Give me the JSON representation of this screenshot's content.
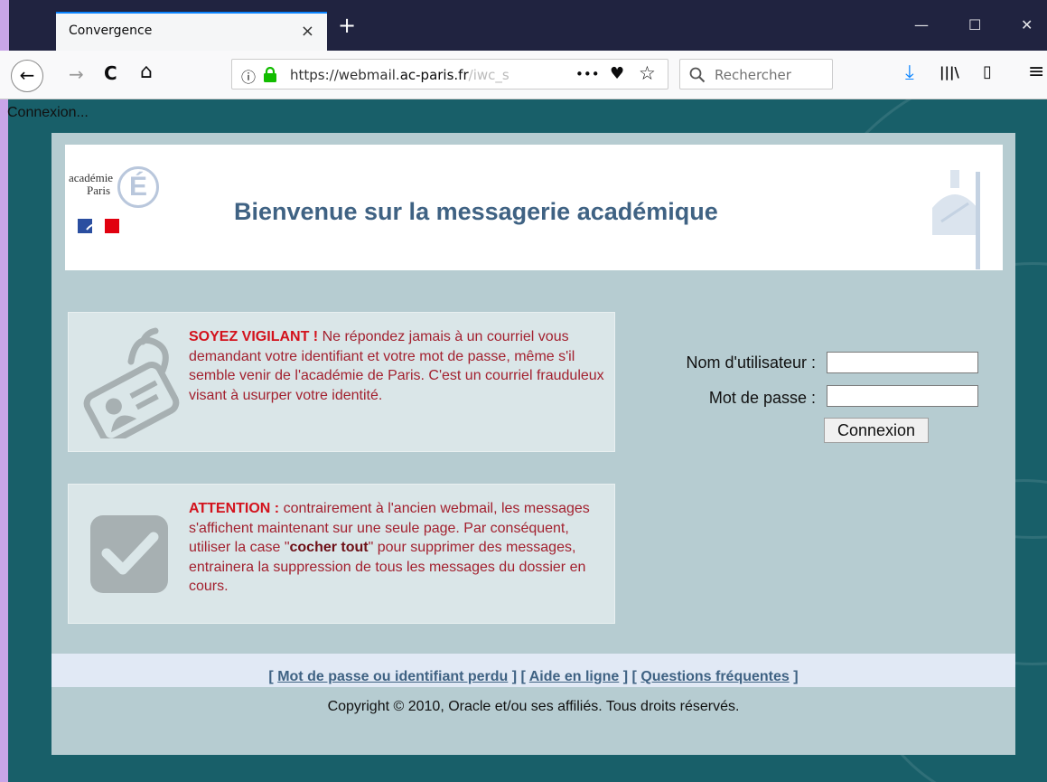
{
  "browser": {
    "tab_title": "Convergence",
    "tab_close": "×",
    "new_tab": "+",
    "window_min": "—",
    "window_max": "☐",
    "window_close": "✕",
    "nav": {
      "back": "←",
      "forward": "→",
      "reload": "C",
      "home": "⌂"
    },
    "url": {
      "info": "ⓘ",
      "prefix": "https://webmail.",
      "host": "ac-paris.fr",
      "rest": "/iwc_s"
    },
    "page_actions": "•••",
    "pocket": "♥",
    "bookmark_star": "☆",
    "search_placeholder": "Rechercher",
    "download": "⤓",
    "library": "|||\\",
    "sidebar": "▯",
    "menu": "≡"
  },
  "page": {
    "status": "Connexion...",
    "logo": {
      "line1": "académie",
      "line2": "Paris",
      "letter": "É"
    },
    "welcome": "Bienvenue sur la messagerie académique",
    "notice1": {
      "warn": "SOYEZ VIGILANT !",
      "text": " Ne répondez jamais à un courriel vous demandant votre identifiant et votre mot de passe, même s'il semble venir de l'académie de Paris. C'est un courriel frauduleux visant à usurper votre identité."
    },
    "notice2": {
      "warn": "ATTENTION :",
      "text_before": " contrairement à l'ancien webmail, les messages s'affichent maintenant sur une seule page. Par conséquent, utiliser la case \"",
      "bold": "cocher tout",
      "text_after": "\" pour supprimer des messages, entrainera la suppression de tous les messages du dossier en cours."
    },
    "form": {
      "username_label": "Nom d'utilisateur :",
      "username_value": "",
      "password_label": "Mot de passe :",
      "password_value": "",
      "submit": "Connexion"
    },
    "footer": {
      "open1": "[ ",
      "link1": "Mot de passe ou identifiant perdu",
      "sep1": " ] [ ",
      "link2": "Aide en ligne",
      "sep2": " ] [ ",
      "link3": "Questions fréquentes",
      "close": " ]",
      "copyright": "Copyright © 2010, Oracle et/ou ses affiliés. Tous droits réservés."
    }
  },
  "colors": {
    "page_bg": "#185f69",
    "panel_bg": "#b6ccd1",
    "title_blue": "#3f6283",
    "warn_red": "#d3121c",
    "text_red": "#a3212f"
  }
}
